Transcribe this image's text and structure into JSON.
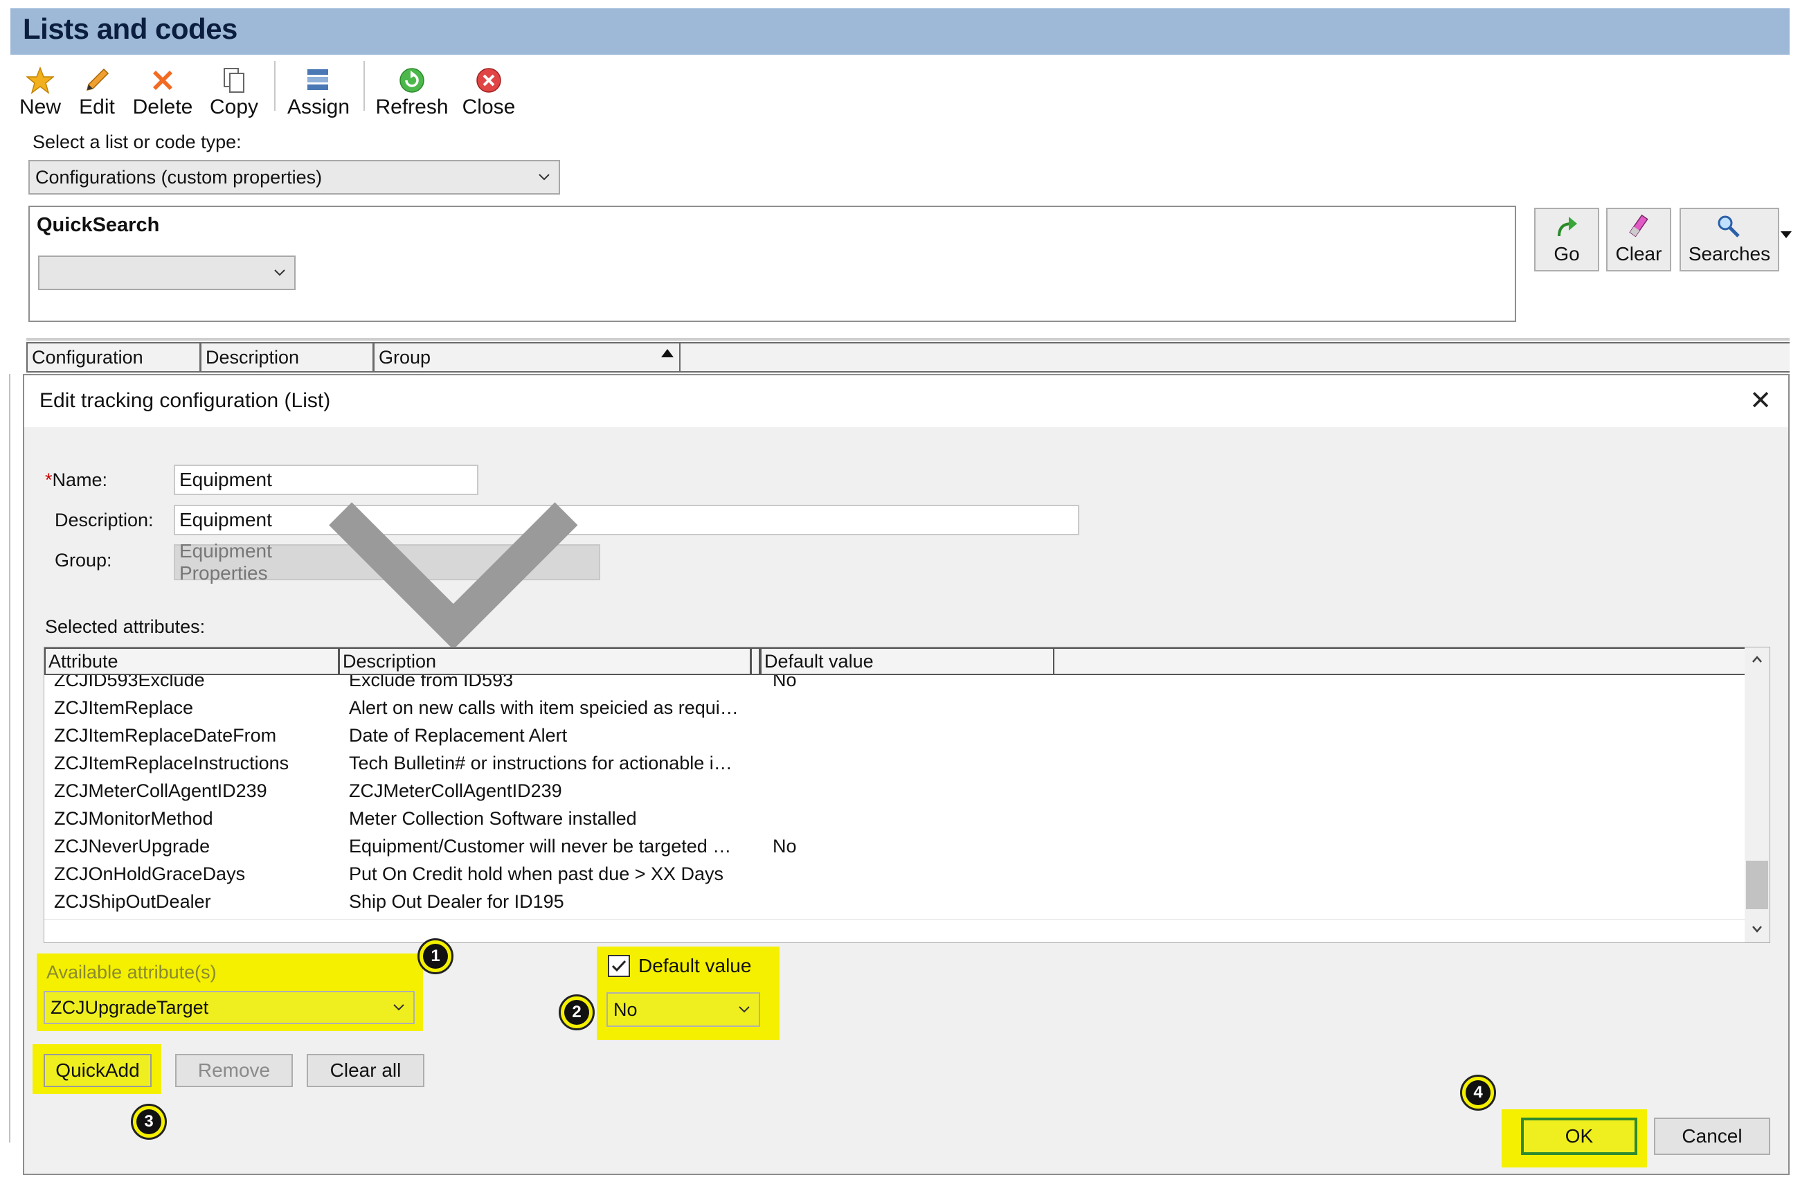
{
  "window": {
    "title": "Lists and codes"
  },
  "toolbar": {
    "new": "New",
    "edit": "Edit",
    "delete": "Delete",
    "copy": "Copy",
    "assign": "Assign",
    "refresh": "Refresh",
    "close": "Close"
  },
  "type_select": {
    "label": "Select a list or code type:",
    "value": "Configurations (custom properties)"
  },
  "quicksearch": {
    "title": "QuickSearch",
    "value": ""
  },
  "search_buttons": {
    "go": "Go",
    "clear": "Clear",
    "searches": "Searches"
  },
  "list_columns": [
    "Configuration",
    "Description",
    "Group"
  ],
  "dialog": {
    "title": "Edit tracking configuration (List)",
    "name_label": "Name:",
    "name_required_mark": "*",
    "name_value": "Equipment",
    "description_label": "Description:",
    "description_value": "Equipment",
    "group_label": "Group:",
    "group_value": "Equipment Properties",
    "selected_label": "Selected attributes:",
    "columns": [
      "Attribute",
      "Description",
      "Default value"
    ],
    "rows": [
      {
        "attribute": "ZCJID593Exclude",
        "description": "Exclude from ID593",
        "default": "No"
      },
      {
        "attribute": "ZCJItemReplace",
        "description": "Alert on new calls with item speicied as requi…",
        "default": ""
      },
      {
        "attribute": "ZCJItemReplaceDateFrom",
        "description": "Date of Replacement Alert",
        "default": ""
      },
      {
        "attribute": "ZCJItemReplaceInstructions",
        "description": "Tech Bulletin# or instructions for actionable i…",
        "default": ""
      },
      {
        "attribute": "ZCJMeterCollAgentID239",
        "description": "ZCJMeterCollAgentID239",
        "default": ""
      },
      {
        "attribute": "ZCJMonitorMethod",
        "description": "Meter Collection Software installed",
        "default": ""
      },
      {
        "attribute": "ZCJNeverUpgrade",
        "description": "Equipment/Customer will never be targeted …",
        "default": "No"
      },
      {
        "attribute": "ZCJOnHoldGraceDays",
        "description": "Put On Credit hold when past due > XX Days",
        "default": ""
      },
      {
        "attribute": "ZCJShipOutDealer",
        "description": "Ship Out Dealer for ID195",
        "default": ""
      }
    ],
    "available_label": "Available attribute(s)",
    "available_value": "ZCJUpgradeTarget",
    "default_checkbox_label": "Default value",
    "default_checked": true,
    "default_value": "No",
    "quickadd": "QuickAdd",
    "remove": "Remove",
    "clear_all": "Clear all",
    "ok": "OK",
    "cancel": "Cancel",
    "close_glyph": "✕"
  },
  "callouts": [
    "1",
    "2",
    "3",
    "4"
  ],
  "colors": {
    "title_bar": "#9eb9d8",
    "highlight": "#f4f000",
    "ok_border": "#2e8b2e"
  }
}
